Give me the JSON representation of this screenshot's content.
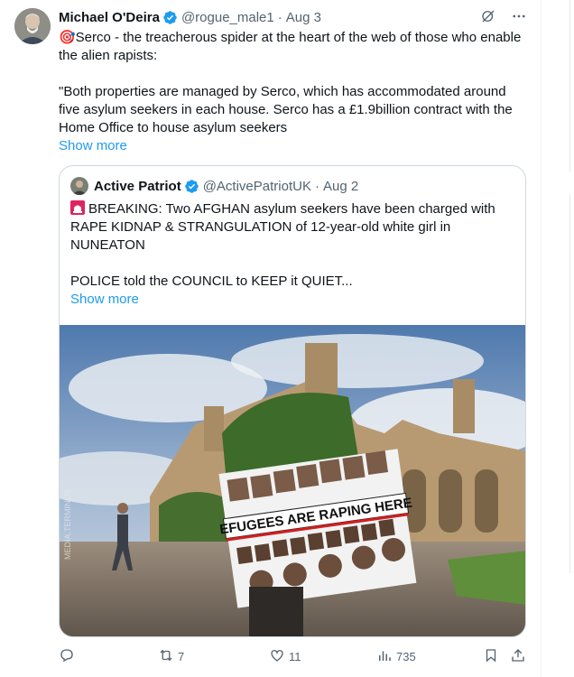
{
  "tweet": {
    "author_name": "Michael O'Deira",
    "handle": "@rogue_male1",
    "separator": "·",
    "date": "Aug 3",
    "paragraph1": "🎯Serco - the treacherous spider at the heart of the web of those who enable the alien rapists:",
    "paragraph2": "\"Both properties are managed by Serco, which has accommodated around five asylum seekers in each house. Serco has a £1.9billion contract with the Home Office to house asylum seekers",
    "show_more": "Show more"
  },
  "quote": {
    "author_name": "Active Patriot",
    "handle": "@ActivePatriotUK",
    "separator": "·",
    "date": "Aug 2",
    "paragraph1": "BREAKING: Two AFGHAN asylum seekers have been charged with RAPE KIDNAP & STRANGULATION of 12-year-old white girl in NUNEATON",
    "paragraph2": "POLICE told the COUNCIL to KEEP it QUIET...",
    "show_more": "Show more",
    "banner_text": "EFUGEES ARE RAPING HERE",
    "watermark": "MEDIA.TERMINUS"
  },
  "actions": {
    "replies": "",
    "reposts": "7",
    "likes": "11",
    "views": "735"
  },
  "colors": {
    "accent": "#1d9bf0",
    "text": "#0f1419",
    "muted": "#536471",
    "border": "#cfd9de"
  },
  "icons": {
    "verified": "verified-badge-icon",
    "grok": "grok-icon",
    "more": "more-icon",
    "reply": "reply-icon",
    "repost": "repost-icon",
    "like": "like-icon",
    "views": "views-icon",
    "bookmark": "bookmark-icon",
    "share": "share-icon",
    "siren": "siren-icon",
    "target": "target-icon"
  }
}
